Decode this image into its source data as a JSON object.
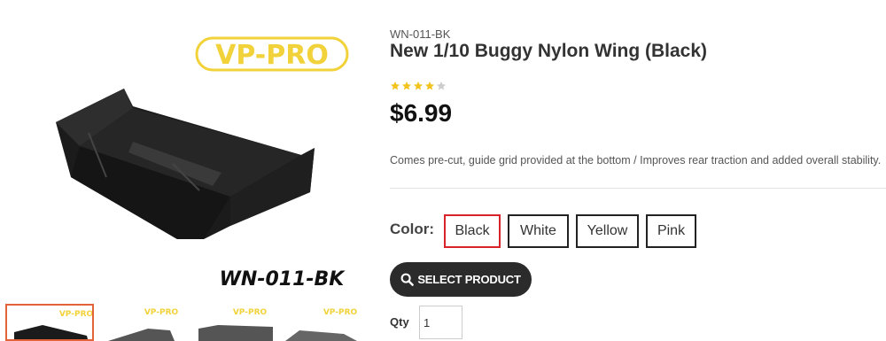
{
  "gallery": {
    "main_image": {
      "brand_logo": "VP-PRO",
      "part_code": "WN-011-BK"
    },
    "thumbnails": [
      {
        "logo": "VP-PRO",
        "active": true
      },
      {
        "logo": "VP-PRO",
        "active": false
      },
      {
        "logo": "VP-PRO",
        "active": false
      },
      {
        "logo": "VP-PRO",
        "active": false
      }
    ]
  },
  "product": {
    "sku": "WN-011-BK",
    "title": "New 1/10 Buggy Nylon Wing (Black)",
    "rating": {
      "filled": 4,
      "total": 5
    },
    "price": "$6.99",
    "description": "Comes pre-cut, guide grid provided at the bottom / Improves rear traction and added overall stability."
  },
  "options": {
    "color_label": "Color:",
    "colors": [
      "Black",
      "White",
      "Yellow",
      "Pink"
    ],
    "selected_color": "Black"
  },
  "actions": {
    "select_product_label": "SELECT PRODUCT",
    "search_icon": "search-icon"
  },
  "quantity": {
    "label": "Qty",
    "value": "1"
  },
  "colors": {
    "brand_yellow": "#f2d23a",
    "star_filled": "#f2c31c",
    "star_empty": "#cccccc",
    "selected_border": "#d8232a",
    "thumb_active_border": "#e2633a",
    "button_bg": "#2b2b2b"
  }
}
